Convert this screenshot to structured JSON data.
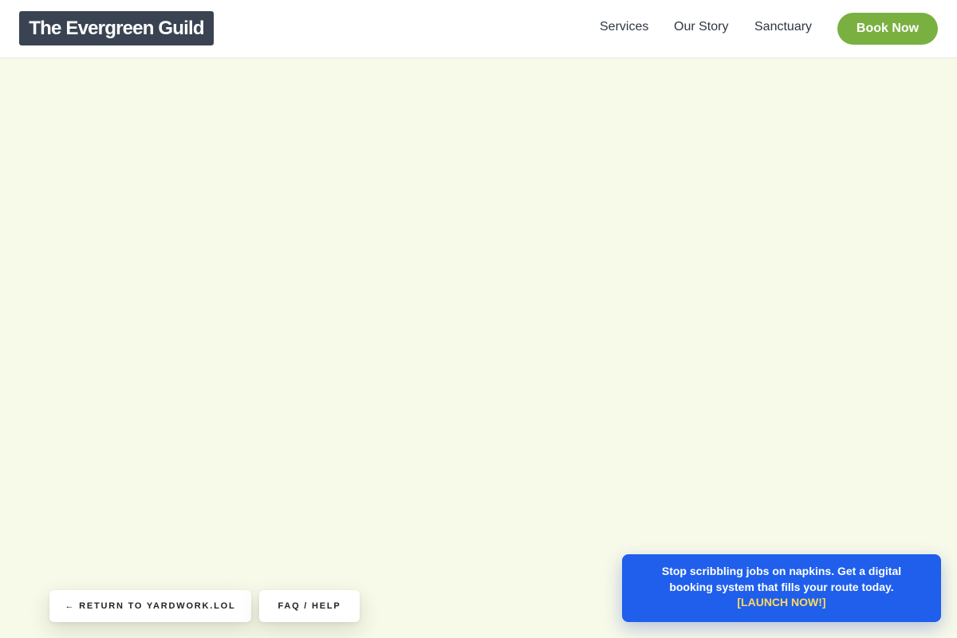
{
  "header": {
    "logo": "The Evergreen Guild",
    "nav": {
      "services": "Services",
      "story": "Our Story",
      "sanctuary": "Sanctuary"
    },
    "cta": "Book Now"
  },
  "footer_buttons": {
    "return": "← RETURN TO YARDWORK.LOL",
    "faq": "FAQ / HELP"
  },
  "promo": {
    "text": "Stop scribbling jobs on napkins. Get a digital booking system that fills your route today.",
    "link": "[LAUNCH NOW!]"
  },
  "colors": {
    "page_background": "#f7f9e9",
    "logo_background": "#3a4351",
    "cta_green": "#7ab040",
    "promo_blue": "#1f5fec",
    "promo_link_yellow": "#ffd95a"
  }
}
